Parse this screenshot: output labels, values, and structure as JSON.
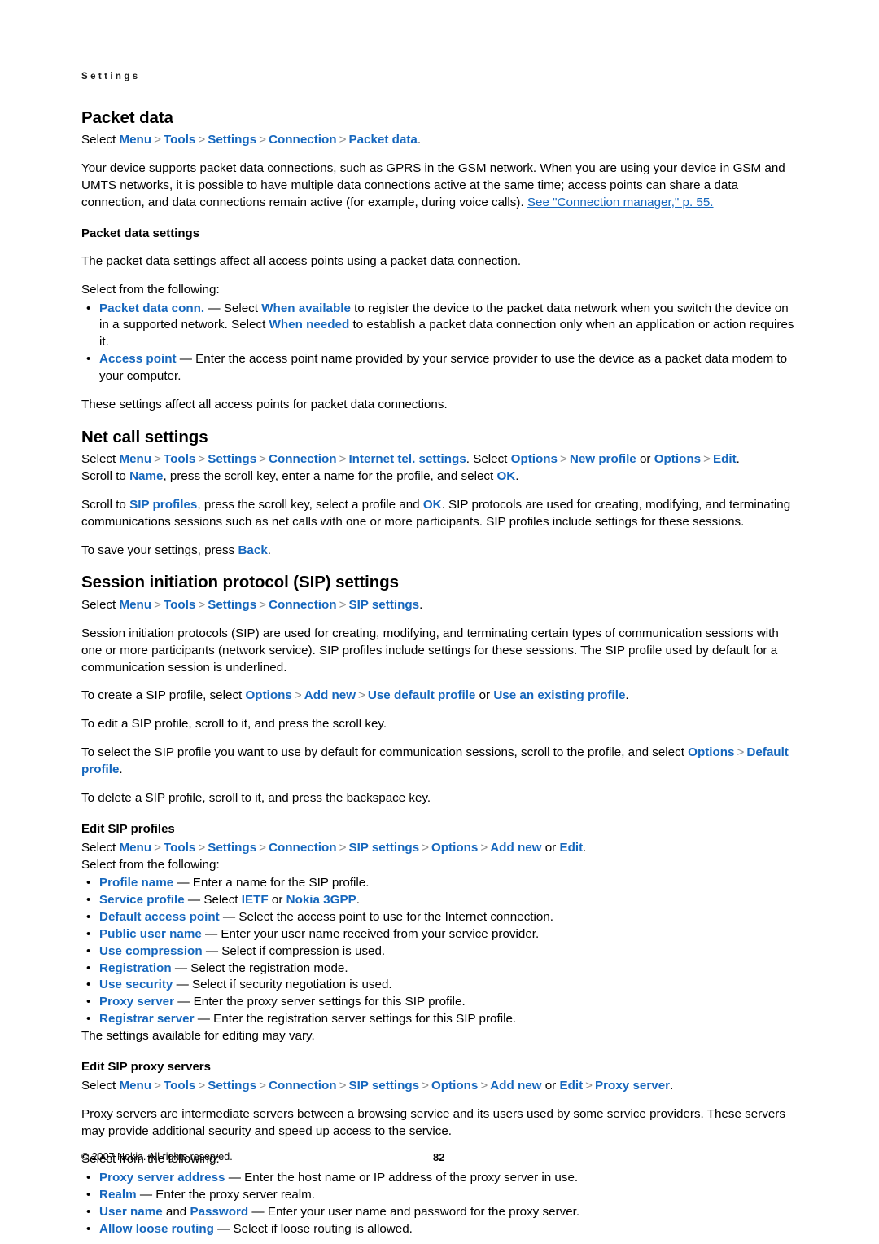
{
  "page": {
    "running_head": "Settings",
    "number": "82",
    "copyright": "© 2007 Nokia. All rights reserved.",
    "accent_color": "#1667bd",
    "separator_color": "#8c8c8c"
  },
  "sections": {
    "packet_data": {
      "title": "Packet data",
      "path": {
        "lead": "Select",
        "items": [
          "Menu",
          "Tools",
          "Settings",
          "Connection",
          "Packet data"
        ],
        "trail": "."
      },
      "intro_1": "Your device supports packet data connections, such as GPRS in the GSM network. When you are using your device in GSM and UMTS networks, it is possible to have multiple data connections active at the same time; access points can share a data connection, and data connections remain active (for example, during voice calls).",
      "intro_xref": "See \"Connection manager,\" p. 55.",
      "subtitle": "Packet data settings",
      "para_1": "The packet data settings affect all access points using a packet data connection.",
      "para_2": "Select from the following:",
      "bullets": [
        {
          "term": "Packet data conn.",
          "text_1": " — Select ",
          "kw_1": "When available",
          "text_2": " to register the device to the packet data network when you switch the device on in a supported network. Select ",
          "kw_2": "When needed",
          "text_3": " to establish a packet data connection only when an application or action requires it."
        },
        {
          "term": "Access point",
          "text_1": " — Enter the access point name provided by your service provider to use the device as a packet data modem to your computer."
        }
      ],
      "para_3": "These settings affect all access points for packet data connections."
    },
    "net_call": {
      "title": "Net call settings",
      "path": {
        "lead": "Select",
        "items": [
          "Menu",
          "Tools",
          "Settings",
          "Connection",
          "Internet tel. settings"
        ],
        "mid_text": ". Select ",
        "options": "Options",
        "new_profile": "New profile",
        "or_text": " or ",
        "options_2": "Options",
        "edit": "Edit",
        "trail": "."
      },
      "para_1_a": "Scroll to ",
      "para_1_kw": "Name",
      "para_1_b": ", press the scroll key, enter a name for the profile, and select ",
      "para_1_kw2": "OK",
      "para_1_c": ".",
      "para_2_a": "Scroll to ",
      "para_2_kw": "SIP profiles",
      "para_2_b": ", press the scroll key, select a profile and ",
      "para_2_kw2": "OK",
      "para_2_c": ". SIP protocols are used for creating, modifying, and terminating communications sessions such as net calls with one or more participants. SIP profiles include settings for these sessions.",
      "para_3_a": "To save your settings, press ",
      "para_3_kw": "Back",
      "para_3_b": "."
    },
    "sip": {
      "title": "Session initiation protocol (SIP) settings",
      "path": {
        "lead": "Select",
        "items": [
          "Menu",
          "Tools",
          "Settings",
          "Connection",
          "SIP settings"
        ],
        "trail": "."
      },
      "para_1": "Session initiation protocols (SIP) are used for creating, modifying, and terminating certain types of communication sessions with one or more participants (network service). SIP profiles include settings for these sessions. The SIP profile used by default for a communication session is underlined.",
      "para_2_a": "To create a SIP profile, select ",
      "para_2_kw1": "Options",
      "para_2_kw2": "Add new",
      "para_2_kw3": "Use default profile",
      "para_2_or": " or ",
      "para_2_kw4": "Use an existing profile",
      "para_2_end": ".",
      "para_3": "To edit a SIP profile, scroll to it, and press the scroll key.",
      "para_4_a": "To select the SIP profile you want to use by default for communication sessions, scroll to the profile, and select ",
      "para_4_kw1": "Options",
      "para_4_kw2": "Default profile",
      "para_4_end": ".",
      "para_5": "To delete a SIP profile, scroll to it, and press the backspace key."
    },
    "edit_sip_profiles": {
      "subtitle": "Edit SIP profiles",
      "path": {
        "lead": "Select",
        "items": [
          "Menu",
          "Tools",
          "Settings",
          "Connection",
          "SIP settings",
          "Options",
          "Add new"
        ],
        "or_text": " or ",
        "edit": "Edit",
        "trail": "."
      },
      "para_1": "Select from the following:",
      "bullets": [
        {
          "term": "Profile name",
          "text_1": " — Enter a name for the SIP profile."
        },
        {
          "term": "Service profile",
          "text_1": " — Select ",
          "kw_1": "IETF",
          "text_2": " or ",
          "kw_2": "Nokia 3GPP",
          "text_3": "."
        },
        {
          "term": "Default access point",
          "text_1": " — Select the access point to use for the Internet connection."
        },
        {
          "term": "Public user name",
          "text_1": " — Enter your user name received from your service provider."
        },
        {
          "term": "Use compression",
          "text_1": " — Select if compression is used."
        },
        {
          "term": "Registration",
          "text_1": " — Select the registration mode."
        },
        {
          "term": "Use security",
          "text_1": " — Select if security negotiation is used."
        },
        {
          "term": "Proxy server",
          "text_1": " — Enter the proxy server settings for this SIP profile."
        },
        {
          "term": "Registrar server",
          "text_1": " — Enter the registration server settings for this SIP profile."
        }
      ],
      "para_2": "The settings available for editing may vary."
    },
    "edit_sip_proxy": {
      "subtitle": "Edit SIP proxy servers",
      "path": {
        "lead": "Select",
        "items": [
          "Menu",
          "Tools",
          "Settings",
          "Connection",
          "SIP settings",
          "Options",
          "Add new"
        ],
        "or_text": " or ",
        "edit": "Edit",
        "last": "Proxy server",
        "trail": "."
      },
      "para_1": "Proxy servers are intermediate servers between a browsing service and its users used by some service providers. These servers may provide additional security and speed up access to the service.",
      "para_2": "Select from the following:",
      "bullets": [
        {
          "term": "Proxy server address",
          "text_1": " — Enter the host name or IP address of the proxy server in use."
        },
        {
          "term": "Realm",
          "text_1": " — Enter the proxy server realm."
        },
        {
          "term": "User name",
          "text_1": " and ",
          "kw_1": "Password",
          "text_2": " — Enter your user name and password for the proxy server."
        },
        {
          "term": "Allow loose routing",
          "text_1": " — Select if loose routing is allowed."
        }
      ]
    }
  }
}
